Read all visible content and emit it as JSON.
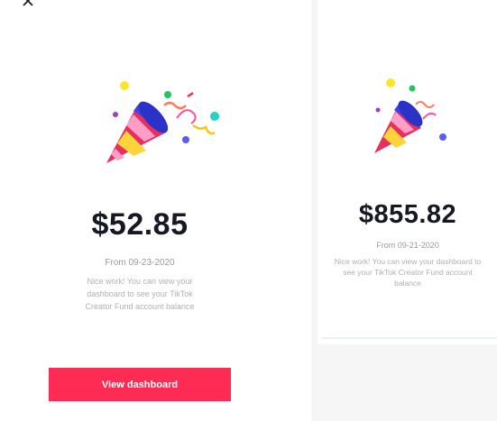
{
  "left_card": {
    "amount": "$52.85",
    "date": "From 09-23-2020",
    "message": "Nice work! You can view your dashboard to see your TikTok Creator Fund account balance",
    "button_label": "View dashboard"
  },
  "right_card": {
    "amount": "$855.82",
    "date": "From 09-21-2020",
    "message": "Nice work! You can view your dashboard to see your TikTok Creator Fund account balance"
  },
  "colors": {
    "accent": "#fe2c55",
    "text_dark": "#161823",
    "text_muted": "#9a9a9a"
  },
  "icons": [
    "close-icon",
    "party-popper-icon"
  ]
}
